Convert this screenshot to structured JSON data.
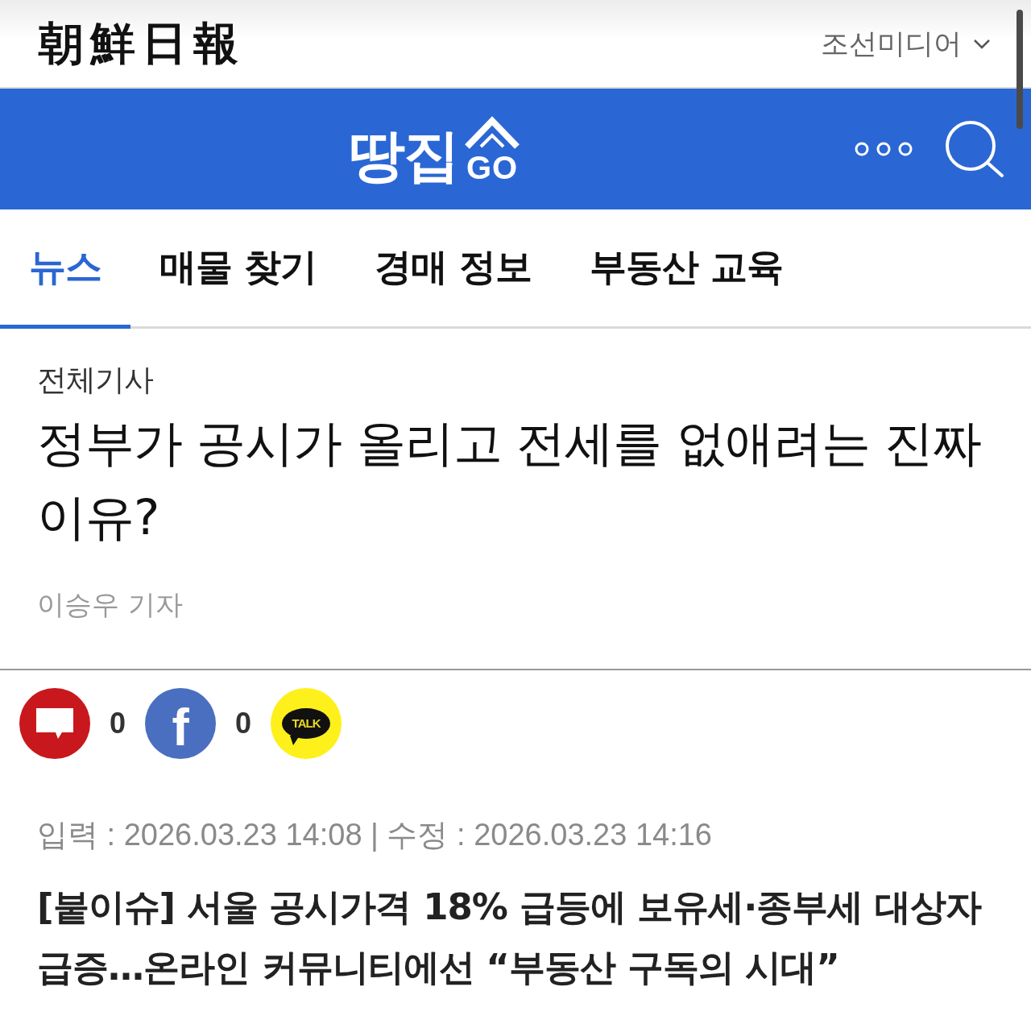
{
  "header": {
    "logo": "朝鮮日報",
    "media_menu": "조선미디어"
  },
  "brand_bar": {
    "logo": "땅집",
    "logo_suffix": "GO"
  },
  "tabs": [
    {
      "label": "뉴스",
      "selected": true
    },
    {
      "label": "매물 찾기",
      "selected": false
    },
    {
      "label": "경매 정보",
      "selected": false
    },
    {
      "label": "부동산 교육",
      "selected": false
    }
  ],
  "article": {
    "category": "전체기사",
    "title": "정부가 공시가 올리고 전세를 없애려는 진짜 이유?",
    "author": "이승우 기자",
    "share": [
      {
        "kind": "comment",
        "count": "0"
      },
      {
        "kind": "facebook",
        "label": "f",
        "count": "0"
      },
      {
        "kind": "kakaotalk",
        "label": "TALK"
      }
    ],
    "timestamps": "입력 : 2026.03.23 14:08 | 수정 : 2026.03.23 14:16",
    "subtitle": "[붙이슈] 서울 공시가격 18% 급등에 보유세·종부세 대상자 급증…온라인 커뮤니티에선 “부동산 구독의 시대”"
  }
}
